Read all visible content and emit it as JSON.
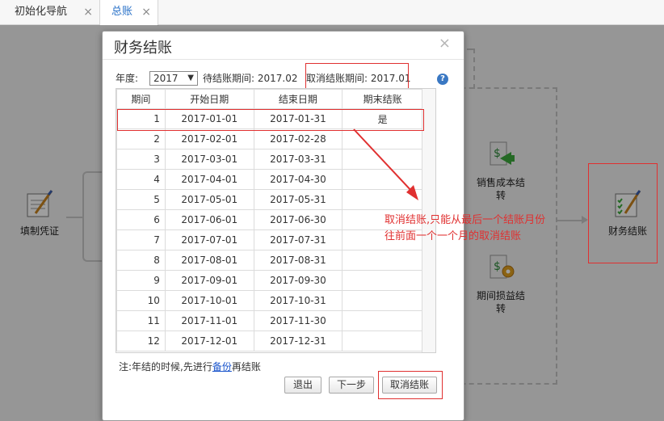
{
  "tabs": [
    {
      "label": "初始化导航"
    },
    {
      "label": "总账"
    }
  ],
  "workflow": {
    "voucher_label": "填制凭证",
    "cost_transfer_label_1": "销售成本结",
    "cost_transfer_label_2": "转",
    "pl_transfer_label_1": "期间损益结",
    "pl_transfer_label_2": "转",
    "closing_label": "财务结账"
  },
  "dialog": {
    "title": "财务结账",
    "close_icon": "×",
    "year_label": "年度:",
    "year_value": "2017",
    "pending_label": "待结账期间: 2017.02",
    "cancel_period_label": "取消结账期间: 2017.01",
    "help_icon": "?",
    "columns": [
      "期间",
      "开始日期",
      "结束日期",
      "期末结账"
    ],
    "rows": [
      {
        "period": "1",
        "start": "2017-01-01",
        "end": "2017-01-31",
        "closed": "是"
      },
      {
        "period": "2",
        "start": "2017-02-01",
        "end": "2017-02-28",
        "closed": ""
      },
      {
        "period": "3",
        "start": "2017-03-01",
        "end": "2017-03-31",
        "closed": ""
      },
      {
        "period": "4",
        "start": "2017-04-01",
        "end": "2017-04-30",
        "closed": ""
      },
      {
        "period": "5",
        "start": "2017-05-01",
        "end": "2017-05-31",
        "closed": ""
      },
      {
        "period": "6",
        "start": "2017-06-01",
        "end": "2017-06-30",
        "closed": ""
      },
      {
        "period": "7",
        "start": "2017-07-01",
        "end": "2017-07-31",
        "closed": ""
      },
      {
        "period": "8",
        "start": "2017-08-01",
        "end": "2017-08-31",
        "closed": ""
      },
      {
        "period": "9",
        "start": "2017-09-01",
        "end": "2017-09-30",
        "closed": ""
      },
      {
        "period": "10",
        "start": "2017-10-01",
        "end": "2017-10-31",
        "closed": ""
      },
      {
        "period": "11",
        "start": "2017-11-01",
        "end": "2017-11-30",
        "closed": ""
      },
      {
        "period": "12",
        "start": "2017-12-01",
        "end": "2017-12-31",
        "closed": ""
      }
    ],
    "note_prefix": "注:年结的时候,先进行",
    "note_link": "备份",
    "note_suffix": "再结账",
    "btn_exit": "退出",
    "btn_next": "下一步",
    "btn_cancel_close": "取消结账"
  },
  "annotation": {
    "line1": "取消结账,只能从最后一个结账月份",
    "line2": "往前面一个一个月的取消结账"
  },
  "colors": {
    "accent": "#2a72c8",
    "highlight_red": "#e03030",
    "link": "#1a55cc"
  }
}
